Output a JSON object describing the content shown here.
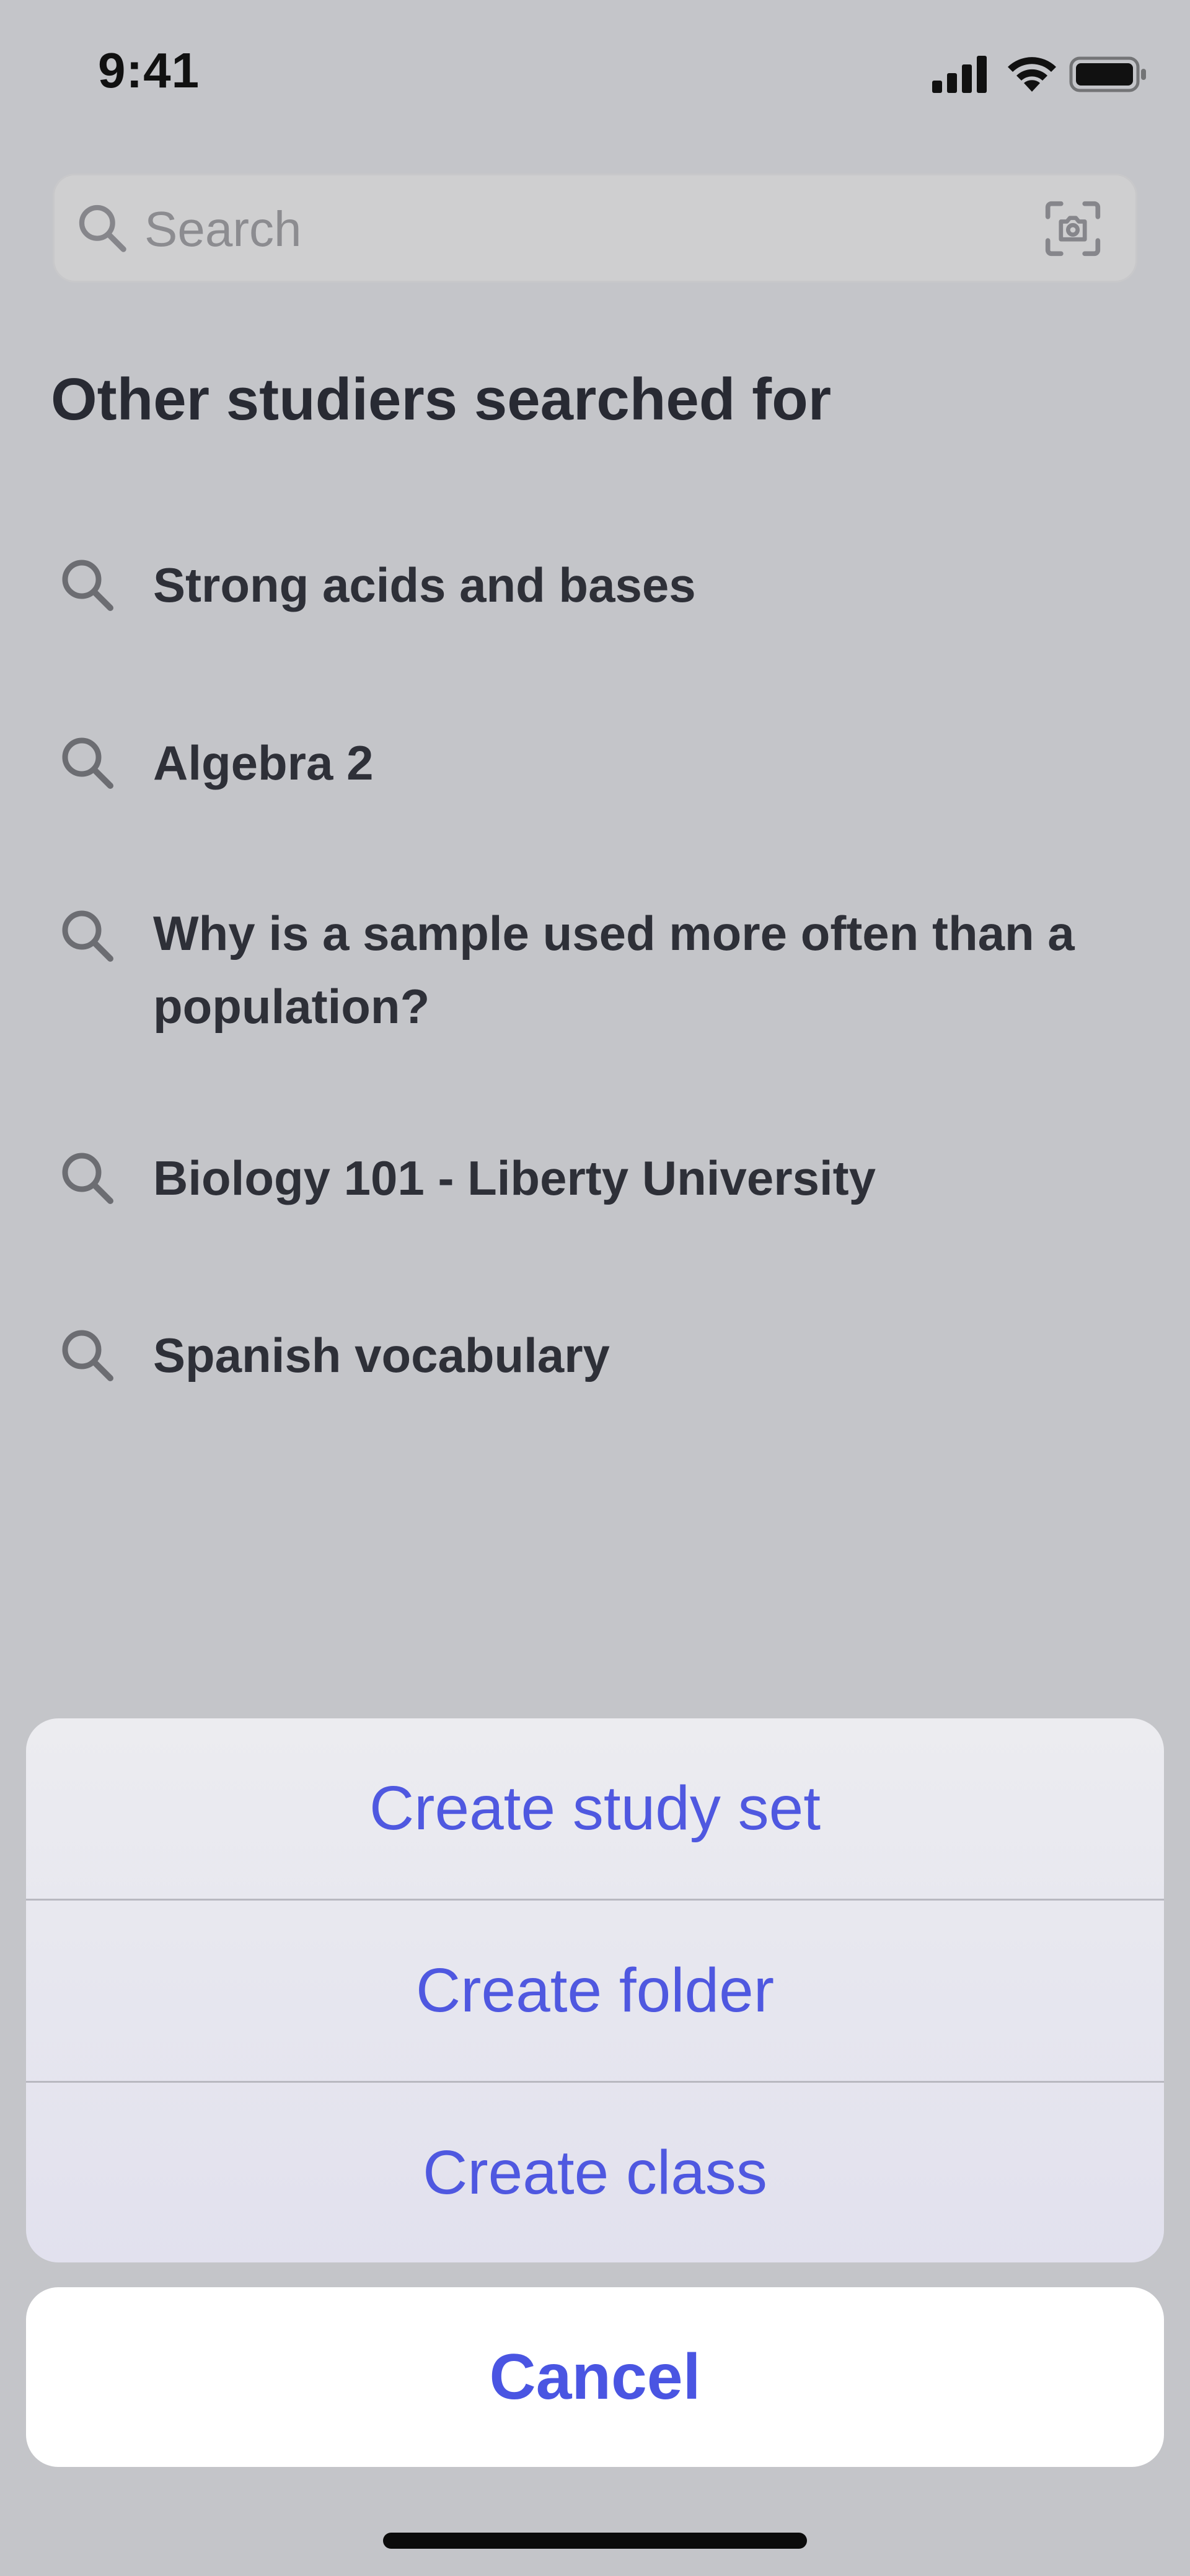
{
  "status_bar": {
    "time": "9:41"
  },
  "search": {
    "placeholder": "Search"
  },
  "suggestions": {
    "title": "Other studiers searched for",
    "items": [
      {
        "label": "Strong acids and bases"
      },
      {
        "label": "Algebra 2"
      },
      {
        "label": "Why is a sample used more often than a population?"
      },
      {
        "label": "Biology 101 - Liberty University"
      },
      {
        "label": "Spanish vocabulary"
      }
    ]
  },
  "action_sheet": {
    "items": [
      {
        "label": "Create study set"
      },
      {
        "label": "Create folder"
      },
      {
        "label": "Create class"
      }
    ],
    "cancel_label": "Cancel"
  },
  "colors": {
    "accent": "#4f58e0",
    "background": "#c4c5c9",
    "text_dark": "#2e3038"
  },
  "icons": {
    "search": "search-icon",
    "scan": "scan-icon",
    "signal": "cellular-signal-icon",
    "wifi": "wifi-icon",
    "battery": "battery-icon"
  }
}
